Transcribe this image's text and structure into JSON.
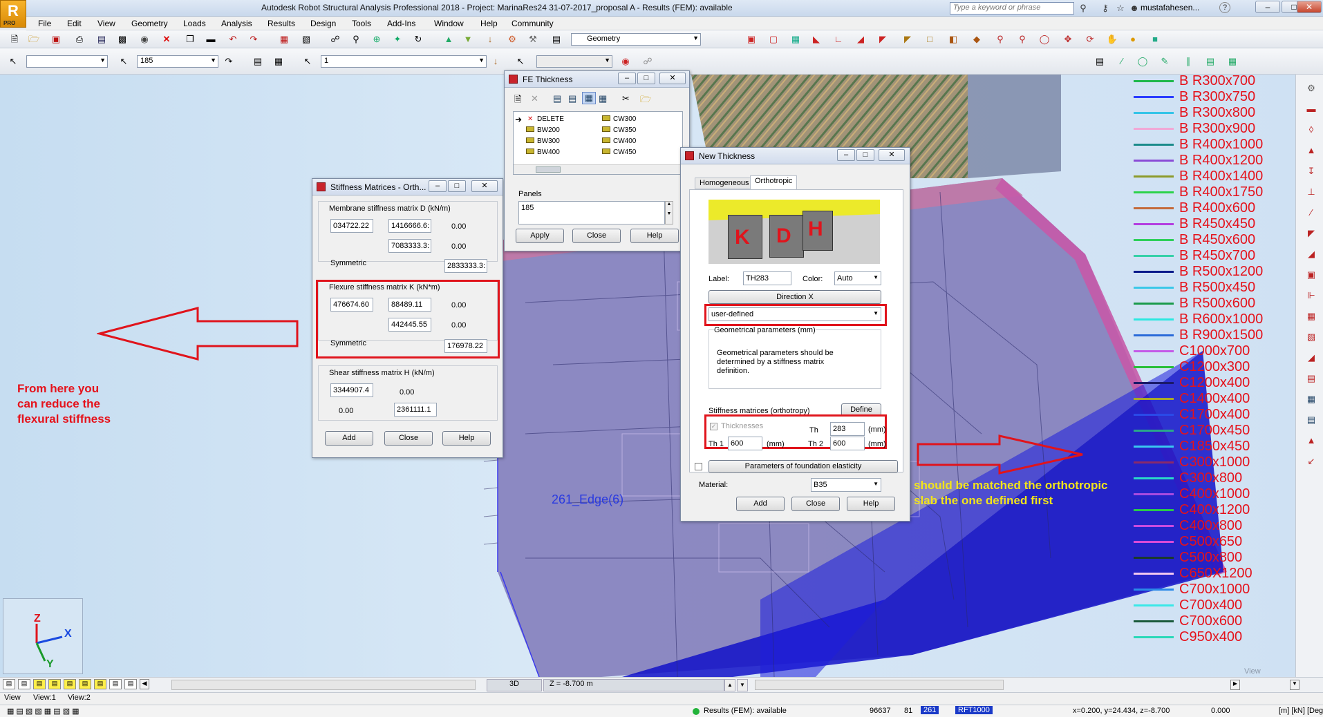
{
  "title_bar": {
    "logo": "R",
    "logo_sub": "PRO",
    "title": "Autodesk Robot Structural Analysis Professional 2018 - Project: MarinaRes24  31-07-2017_proposal A - Results (FEM): available",
    "search_placeholder": "Type a keyword or phrase",
    "user": "mustafahesen...",
    "help": "?"
  },
  "menu": [
    "File",
    "Edit",
    "View",
    "Geometry",
    "Loads",
    "Analysis",
    "Results",
    "Design",
    "Tools",
    "Add-Ins",
    "Window",
    "Help",
    "Community"
  ],
  "toolbar1": {
    "geometry_combo": "Geometry"
  },
  "toolbar2": {
    "combo1": "",
    "combo2": "185",
    "combo3": "1",
    "combo4": ""
  },
  "workspace": {
    "edge_label": "261_Edge(6)",
    "annotation_left": [
      "From here you",
      "can reduce the",
      "flexural stiffness"
    ],
    "annotation_right": [
      "should be matched the orthotropic",
      "slab the one defined first"
    ],
    "view_label": "View",
    "axes": {
      "z": "Z",
      "x": "X",
      "y": "Y"
    }
  },
  "legend": [
    {
      "label": "B R300x700",
      "color": "#1fb84b"
    },
    {
      "label": "B R300x750",
      "color": "#2a3cff"
    },
    {
      "label": "B R300x800",
      "color": "#35c4e8"
    },
    {
      "label": "B R300x900",
      "color": "#f1a8d6"
    },
    {
      "label": "B R400x1000",
      "color": "#1a8a8a"
    },
    {
      "label": "B R400x1200",
      "color": "#8a4bd6"
    },
    {
      "label": "B R400x1400",
      "color": "#8c9a2a"
    },
    {
      "label": "B R400x1750",
      "color": "#2bd24a"
    },
    {
      "label": "B R400x600",
      "color": "#c46a3a"
    },
    {
      "label": "B R450x450",
      "color": "#b43ee0"
    },
    {
      "label": "B R450x600",
      "color": "#2ecf5a"
    },
    {
      "label": "B R450x700",
      "color": "#36d0a8"
    },
    {
      "label": "B R500x1200",
      "color": "#0a1a8a"
    },
    {
      "label": "B R500x450",
      "color": "#3ac8e8"
    },
    {
      "label": "B R500x600",
      "color": "#1a9a4a"
    },
    {
      "label": "B R600x1000",
      "color": "#2be8e0"
    },
    {
      "label": "B R900x1500",
      "color": "#2a6ad8"
    },
    {
      "label": "C1000x700",
      "color": "#c45ae8"
    },
    {
      "label": "C1200x300",
      "color": "#2abf3a"
    },
    {
      "label": "C1200x400",
      "color": "#1a1a6a"
    },
    {
      "label": "C1400x400",
      "color": "#a8a82a"
    },
    {
      "label": "C1700x400",
      "color": "#2a4ae8"
    },
    {
      "label": "C1700x450",
      "color": "#2aa88a"
    },
    {
      "label": "C1850x450",
      "color": "#3ac8f0"
    },
    {
      "label": "C300x1000",
      "color": "#8a2a6a"
    },
    {
      "label": "C300x800",
      "color": "#2ad8c8"
    },
    {
      "label": "C400x1000",
      "color": "#a84ae0"
    },
    {
      "label": "C400x1200",
      "color": "#2ac84a"
    },
    {
      "label": "C400x800",
      "color": "#c84ae0"
    },
    {
      "label": "C500x650",
      "color": "#d84ad8"
    },
    {
      "label": "C500x800",
      "color": "#1a3a2a"
    },
    {
      "label": "C650X1200",
      "color": "#f2c8f0"
    },
    {
      "label": "C700x1000",
      "color": "#2a8ae8"
    },
    {
      "label": "C700x400",
      "color": "#3ae8e8"
    },
    {
      "label": "C700x600",
      "color": "#1a5a3a"
    },
    {
      "label": "C950x400",
      "color": "#2ad8b8"
    }
  ],
  "stiffness_dialog": {
    "title": "Stiffness Matrices - Orth...",
    "membrane_title": "Membrane stiffness matrix D (kN/m)",
    "membrane": {
      "d11": "034722.22",
      "d12": "1416666.6:",
      "d13": "0.00",
      "d22": "7083333.3:",
      "d23": "0.00",
      "symmetric": "Symmetric",
      "d33": "2833333.3:"
    },
    "flexure_title": "Flexure stiffness matrix K (kN*m)",
    "flexure": {
      "k11": "476674.60",
      "k12": "88489.11",
      "k13": "0.00",
      "k22": "442445.55",
      "k23": "0.00",
      "symmetric": "Symmetric",
      "k33": "176978.22"
    },
    "shear_title": "Shear stiffness matrix H (kN/m)",
    "shear": {
      "h11": "3344907.4",
      "h12": "0.00",
      "h21": "0.00",
      "h22": "2361111.1"
    },
    "buttons": {
      "add": "Add",
      "close": "Close",
      "help": "Help"
    }
  },
  "fe_dialog": {
    "title": "FE Thickness",
    "list_left": [
      "DELETE",
      "BW200",
      "BW300",
      "BW400"
    ],
    "list_right": [
      "CW300",
      "CW350",
      "CW400",
      "CW450"
    ],
    "panels_label": "Panels",
    "panels_value": "185",
    "buttons": {
      "apply": "Apply",
      "close": "Close",
      "help": "Help"
    }
  },
  "thickness_dialog": {
    "title": "New Thickness",
    "tabs": [
      "Homogeneous",
      "Orthotropic"
    ],
    "image_letters": [
      "K",
      "D",
      "H"
    ],
    "label_caption": "Label:",
    "label_value": "TH283",
    "color_caption": "Color:",
    "color_value": "Auto",
    "direction_button": "Direction X",
    "type_value": "user-defined",
    "geom_group": "Geometrical parameters (mm)",
    "geom_text": [
      "Geometrical parameters should be",
      "determined by a stiffness matrix",
      "definition."
    ],
    "stiffness_caption": "Stiffness matrices (orthotropy)",
    "define_button": "Define",
    "thicknesses_caption": "Thicknesses",
    "th_caption": "Th",
    "th_value": "283",
    "th1_caption": "Th 1",
    "th1_value": "600",
    "th2_caption": "Th 2",
    "th2_value": "600",
    "unit": "(mm)",
    "foundation_button": "Parameters of foundation elasticity",
    "material_caption": "Material:",
    "material_value": "B35",
    "buttons": {
      "add": "Add",
      "close": "Close",
      "help": "Help"
    }
  },
  "view_bar": {
    "mode": "3D",
    "z_value": "Z = -8.700 m"
  },
  "tabs": [
    "View",
    "View:1",
    "View:2"
  ],
  "status": {
    "results": "Results (FEM): available",
    "n1": "96637",
    "n2": "81",
    "n3": "261",
    "rft": "RFT1000",
    "coords": "x=0.200, y=24.434, z=-8.700",
    "angle": "0.000",
    "units": "[m] [kN] [Deg]"
  }
}
